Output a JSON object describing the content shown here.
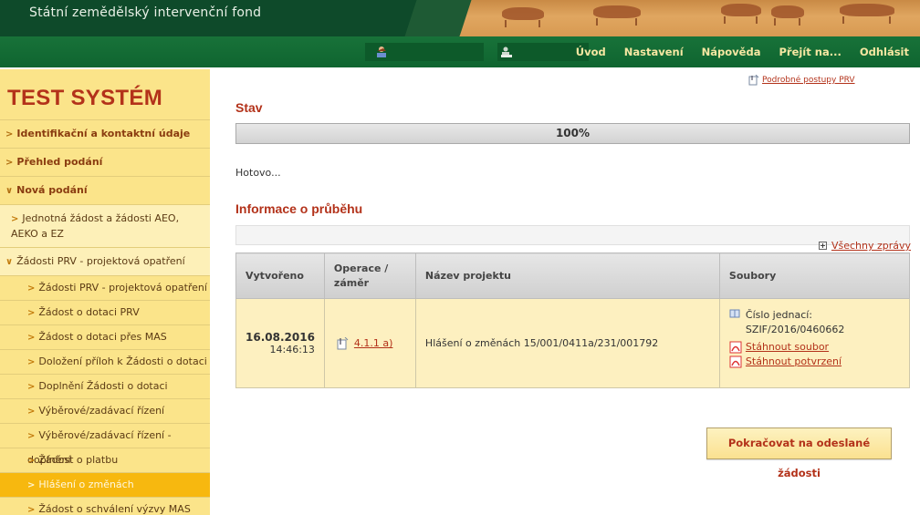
{
  "header": {
    "org_name": "Státní zemědělský intervenční fond"
  },
  "navbar": {
    "user_icon": "user-icon",
    "user2_icon": "user-role-icon",
    "links": [
      "Úvod",
      "Nastavení",
      "Nápověda",
      "Přejít na...",
      "Odhlásit"
    ]
  },
  "sidebar": {
    "title": "TEST SYSTÉM",
    "main_items": [
      {
        "label": "Identifikační a kontaktní údaje",
        "expanded": false
      },
      {
        "label": "Přehled podání",
        "expanded": false
      },
      {
        "label": "Nová podání",
        "expanded": true
      }
    ],
    "sub_items": [
      {
        "label": "Jednotná žádost a žádosti AEO, AEKO a EZ",
        "expanded": false
      },
      {
        "label": "Žádosti PRV - projektová opatření",
        "expanded": true
      }
    ],
    "sub2_items": [
      {
        "label": "Žádosti PRV - projektová opatření",
        "active": false
      },
      {
        "label": "Žádost o dotaci PRV",
        "active": false
      },
      {
        "label": "Žádost o dotaci přes MAS",
        "active": false
      },
      {
        "label": "Doložení příloh k Žádosti o dotaci",
        "active": false
      },
      {
        "label": "Doplnění Žádosti o dotaci",
        "active": false
      },
      {
        "label": "Výběrové/zadávací řízení",
        "active": false
      },
      {
        "label": "Výběrové/zadávací řízení - doplnění",
        "active": false
      },
      {
        "label": "Žádost o platbu",
        "active": false
      },
      {
        "label": "Hlášení o změnách",
        "active": true
      },
      {
        "label": "Žádost o schválení výzvy MAS",
        "active": false
      }
    ]
  },
  "main": {
    "help_link": "Podrobné postupy PRV",
    "stav_title": "Stav",
    "progress": {
      "percent": 100,
      "label": "100%"
    },
    "status_text": "Hotovo...",
    "info_title": "Informace o průběhu",
    "all_messages_link": "Všechny zprávy",
    "table": {
      "headers": [
        "Vytvořeno",
        "Operace / záměr",
        "Název projektu",
        "Soubory"
      ],
      "rows": [
        {
          "date": "16.08.2016",
          "time": "14:46:13",
          "operation": "4.1.1 a)",
          "project_name": "Hlášení o změnách 15/001/0411a/231/001792",
          "files": {
            "ref_label": "Číslo jednací:",
            "ref_value": "SZIF/2016/0460662",
            "download_file": "Stáhnout soubor",
            "download_confirmation": "Stáhnout potvrzení"
          }
        }
      ]
    },
    "continue_button": "Pokračovat na odeslané žádosti"
  },
  "colors": {
    "header_dark_green": "#0e4a2a",
    "nav_green": "#187239",
    "nav_link": "#f6e7a2",
    "accent_red": "#b3321a",
    "sidebar_yellow": "#fbe48a",
    "sidebar_active": "#f7b80f",
    "row_bg": "#fdf0c0"
  }
}
